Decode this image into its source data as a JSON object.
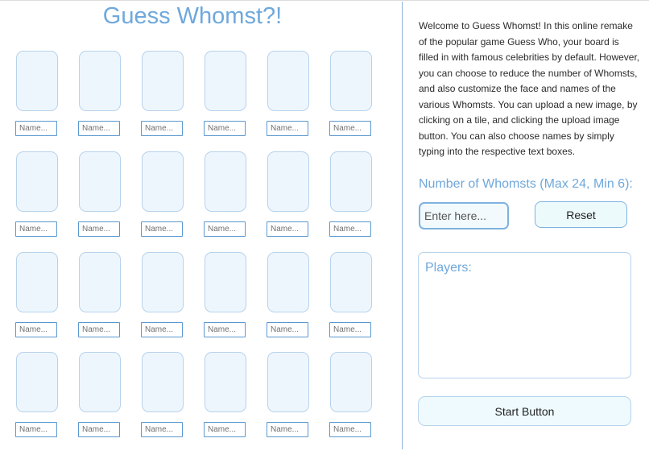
{
  "header": {
    "title": "Guess Whomst?!"
  },
  "board": {
    "tiles": [
      {
        "name_placeholder": "Name..."
      },
      {
        "name_placeholder": "Name..."
      },
      {
        "name_placeholder": "Name..."
      },
      {
        "name_placeholder": "Name..."
      },
      {
        "name_placeholder": "Name..."
      },
      {
        "name_placeholder": "Name..."
      },
      {
        "name_placeholder": "Name..."
      },
      {
        "name_placeholder": "Name..."
      },
      {
        "name_placeholder": "Name..."
      },
      {
        "name_placeholder": "Name..."
      },
      {
        "name_placeholder": "Name..."
      },
      {
        "name_placeholder": "Name..."
      },
      {
        "name_placeholder": "Name..."
      },
      {
        "name_placeholder": "Name..."
      },
      {
        "name_placeholder": "Name..."
      },
      {
        "name_placeholder": "Name..."
      },
      {
        "name_placeholder": "Name..."
      },
      {
        "name_placeholder": "Name..."
      },
      {
        "name_placeholder": "Name..."
      },
      {
        "name_placeholder": "Name..."
      },
      {
        "name_placeholder": "Name..."
      },
      {
        "name_placeholder": "Name..."
      },
      {
        "name_placeholder": "Name..."
      },
      {
        "name_placeholder": "Name..."
      }
    ]
  },
  "sidebar": {
    "intro": "Welcome to Guess Whomst! In this online remake of the popular game Guess Who, your board is filled in with famous celebrities by default.  However, you can choose to reduce the number of Whomsts, and also customize the face and names of the various Whomsts. You can upload a new image, by clicking on a tile, and clicking the upload image button. You can also choose names by simply typing into the respective text boxes.",
    "count_label": "Number of Whomsts (Max 24, Min 6):",
    "count_placeholder": "Enter here...",
    "reset_label": "Reset",
    "players_label": "Players:",
    "start_label": "Start Button"
  }
}
